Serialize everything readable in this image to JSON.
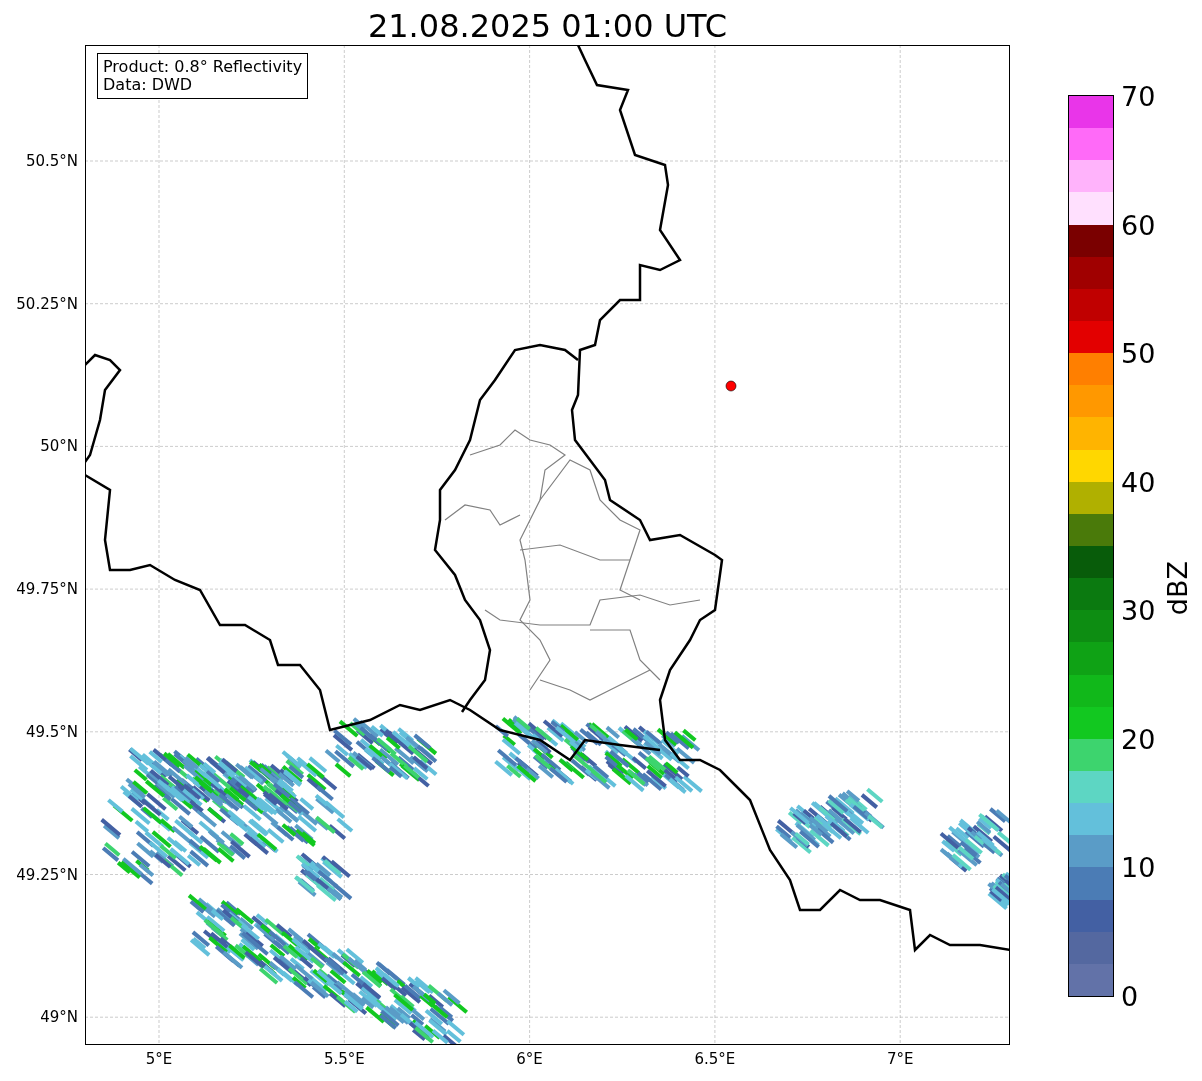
{
  "title": "21.08.2025 01:00 UTC",
  "legend": [
    "Product: 0.8° Reflectivity",
    "Data: DWD"
  ],
  "map": {
    "y_ticks": [
      "50.5°N",
      "50.25°N",
      "50°N",
      "49.75°N",
      "49.5°N",
      "49.25°N",
      "49°N"
    ],
    "x_ticks": [
      "5°E",
      "5.5°E",
      "6°E",
      "6.5°E",
      "7°E"
    ]
  },
  "colorbar": {
    "label": "dBZ",
    "ticks": [
      "70",
      "60",
      "50",
      "40",
      "30",
      "20",
      "10",
      "0"
    ],
    "bands": [
      {
        "color": "#e935e9"
      },
      {
        "color": "#ff6af8"
      },
      {
        "color": "#ffb3fb"
      },
      {
        "color": "#ffe0fe"
      },
      {
        "color": "#7a0000"
      },
      {
        "color": "#a00000"
      },
      {
        "color": "#c00000"
      },
      {
        "color": "#e30000"
      },
      {
        "color": "#ff7f00"
      },
      {
        "color": "#ff9800"
      },
      {
        "color": "#ffb400"
      },
      {
        "color": "#ffd700"
      },
      {
        "color": "#b0b000"
      },
      {
        "color": "#4a7a0a"
      },
      {
        "color": "#085c0a"
      },
      {
        "color": "#0b7a10"
      },
      {
        "color": "#0d8d12"
      },
      {
        "color": "#0fa215"
      },
      {
        "color": "#11b81a"
      },
      {
        "color": "#12c820"
      },
      {
        "color": "#3dd46e"
      },
      {
        "color": "#5dd6c3"
      },
      {
        "color": "#63c0db"
      },
      {
        "color": "#5a9cc7"
      },
      {
        "color": "#4b7cb5"
      },
      {
        "color": "#4360a3"
      },
      {
        "color": "#5468a0"
      },
      {
        "color": "#6272a8"
      }
    ]
  }
}
